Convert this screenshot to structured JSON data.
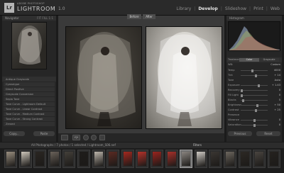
{
  "app": {
    "vendor": "ADOBE PHOTOSHOP",
    "name": "LIGHTROOM",
    "version": "1.0",
    "logo": "Lr"
  },
  "modules": [
    "Library",
    "Develop",
    "Slideshow",
    "Print",
    "Web"
  ],
  "active_module": "Develop",
  "left_panel": {
    "navigator_title": "Navigator",
    "navigator_zoom": "FIT  FILL  1:1",
    "presets_title": "Presets",
    "presets": [
      "Antique Grayscale",
      "Cyanotype",
      "Direct Positive",
      "Grayscale Conversion",
      "Sepia Tone",
      "Tone Curve - Lightroom Default",
      "Tone Curve - Linear Contrast",
      "Tone Curve - Medium Contrast",
      "Tone Curve - Strong Contrast",
      "Zeroed"
    ],
    "copy_label": "Copy...",
    "paste_label": "Paste"
  },
  "center": {
    "before_label": "Before",
    "after_label": "After"
  },
  "toolbar": {
    "compare_label": "Y|Y"
  },
  "right_panel": {
    "histogram_title": "Histogram",
    "basic_title": "Basic",
    "treatment_label": "Treatment:",
    "treatment_options": [
      "Color",
      "Grayscale"
    ],
    "treatment_selected": "Color",
    "wb_label": "WB:",
    "wb_value": "Custom",
    "rows": [
      {
        "label": "Temp",
        "value": "4000",
        "level": 0.42
      },
      {
        "label": "Tint",
        "value": "+ 14",
        "level": 0.56
      },
      {
        "label": "Tone",
        "value": "Auto",
        "level": null
      },
      {
        "label": "Exposure",
        "value": "+ 1.43",
        "level": 0.68
      },
      {
        "label": "Recovery",
        "value": "0",
        "level": 0.0
      },
      {
        "label": "Fill Light",
        "value": "0",
        "level": 0.0
      },
      {
        "label": "Blacks",
        "value": "5",
        "level": 0.05
      },
      {
        "label": "Brightness",
        "value": "+ 50",
        "level": 0.62
      },
      {
        "label": "Contrast",
        "value": "+ 25",
        "level": 0.58
      },
      {
        "label": "Presence",
        "value": "",
        "level": null
      },
      {
        "label": "Vibrance",
        "value": "0",
        "level": 0.5
      },
      {
        "label": "Saturation",
        "value": "0",
        "level": 0.5
      }
    ],
    "previous_label": "Previous",
    "reset_label": "Reset"
  },
  "filmstrip": {
    "path": "All Photographs / 7 photos / 1 selected / Lightroom_S06.nef",
    "filters_label": "Filters",
    "photo_colors": [
      "#9a8f80",
      "#cfc8bc",
      "#2a2622",
      "#6a625a",
      "#44403a",
      "#1e1c1a",
      "#bdb6ac",
      "#5b2a22",
      "#a5281f",
      "#b5322a",
      "#9b241e",
      "#a8302a",
      "#8a8580",
      "#d0ccc6",
      "#3a3632",
      "#6d675f",
      "#2c2824",
      "#4a4540",
      "#25221f"
    ],
    "selected_index": 12
  }
}
